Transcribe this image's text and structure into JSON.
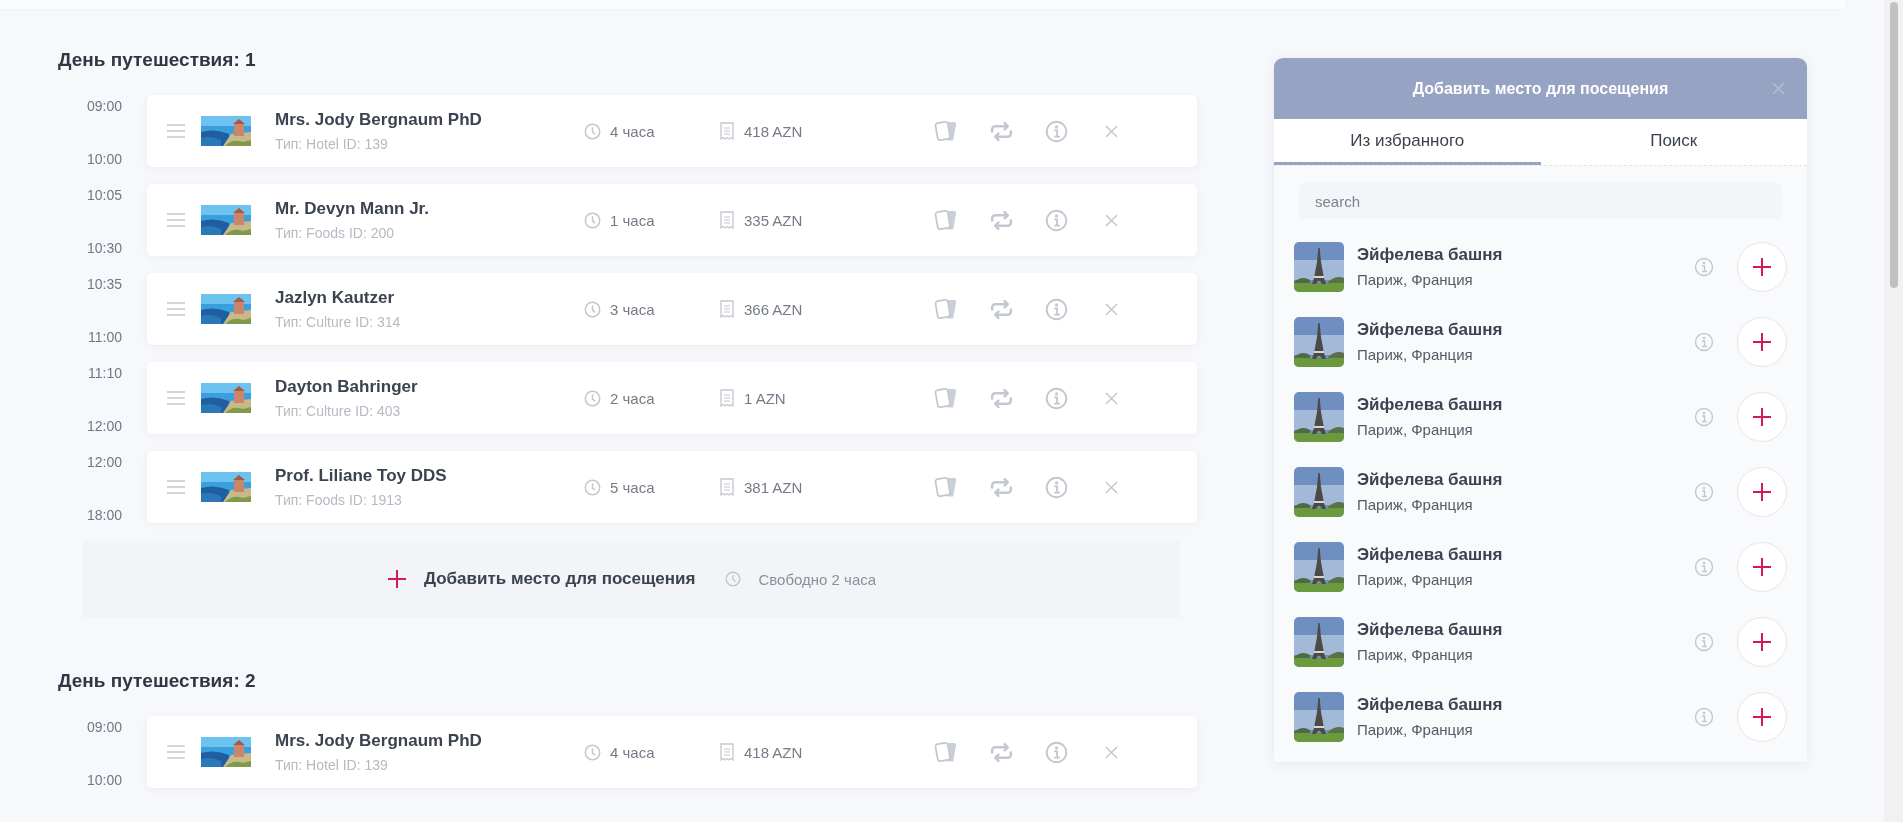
{
  "days": [
    {
      "title": "День путешествия: 1",
      "stops": [
        {
          "start": "09:00",
          "end": "10:00",
          "name": "Mrs. Jody Bergnaum PhD",
          "meta": "Тип: Hotel ID: 139",
          "duration": "4 часа",
          "price": "418 AZN"
        },
        {
          "start": "10:05",
          "end": "10:30",
          "name": "Mr. Devyn Mann Jr.",
          "meta": "Тип: Foods ID: 200",
          "duration": "1 часа",
          "price": "335 AZN"
        },
        {
          "start": "10:35",
          "end": "11:00",
          "name": "Jazlyn Kautzer",
          "meta": "Тип: Culture ID: 314",
          "duration": "3 часа",
          "price": "366 AZN"
        },
        {
          "start": "11:10",
          "end": "12:00",
          "name": "Dayton Bahringer",
          "meta": "Тип: Culture ID: 403",
          "duration": "2 часа",
          "price": "1 AZN"
        },
        {
          "start": "12:00",
          "end": "18:00",
          "name": "Prof. Liliane Toy DDS",
          "meta": "Тип: Foods ID: 1913",
          "duration": "5 часа",
          "price": "381 AZN"
        }
      ],
      "add_bar": {
        "label": "Добавить место для посещения",
        "free": "Свободно 2 часа"
      }
    },
    {
      "title": "День путешествия: 2",
      "stops": [
        {
          "start": "09:00",
          "end": "10:00",
          "name": "Mrs. Jody Bergnaum PhD",
          "meta": "Тип: Hotel ID: 139",
          "duration": "4 часа",
          "price": "418 AZN"
        }
      ]
    }
  ],
  "panel": {
    "title": "Добавить место для посещения",
    "tabs": [
      {
        "label": "Из избранного",
        "selected": true
      },
      {
        "label": "Поиск",
        "selected": false
      }
    ],
    "search": {
      "placeholder": "search"
    },
    "places": [
      {
        "name": "Эйфелева башня",
        "location": "Париж, Франция"
      },
      {
        "name": "Эйфелева башня",
        "location": "Париж, Франция"
      },
      {
        "name": "Эйфелева башня",
        "location": "Париж, Франция"
      },
      {
        "name": "Эйфелева башня",
        "location": "Париж, Франция"
      },
      {
        "name": "Эйфелева башня",
        "location": "Париж, Франция"
      },
      {
        "name": "Эйфелева башня",
        "location": "Париж, Франция"
      },
      {
        "name": "Эйфелева башня",
        "location": "Париж, Франция"
      }
    ]
  }
}
